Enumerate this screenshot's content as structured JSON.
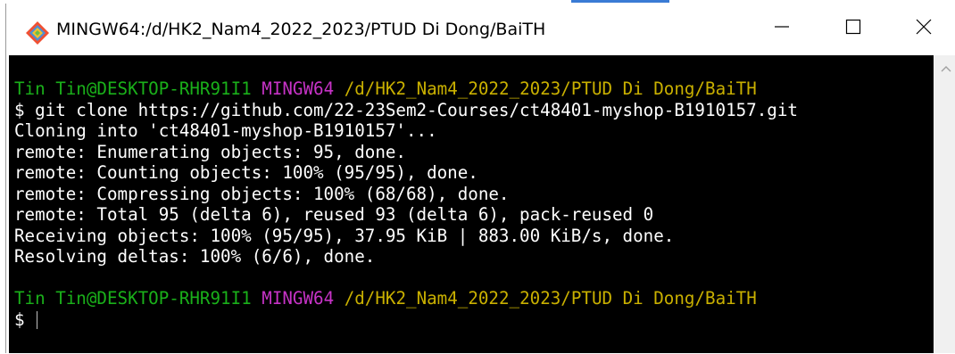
{
  "window": {
    "title": "MINGW64:/d/HK2_Nam4_2022_2023/PTUD Di Dong/BaiTH",
    "icon": "git-bash-icon",
    "controls": [
      "minimize-icon",
      "maximize-icon",
      "close-icon"
    ]
  },
  "terminal": {
    "colors": {
      "background": "#000000",
      "text": "#ffffff",
      "user_host": "#1ab01a",
      "shell": "#c733c7",
      "path": "#c9b000"
    },
    "prompt1": {
      "user_host": "Tin Tin@DESKTOP-RHR91I1",
      "shell": "MINGW64",
      "path": "/d/HK2_Nam4_2022_2023/PTUD Di Dong/BaiTH"
    },
    "command": "$ git clone https://github.com/22-23Sem2-Courses/ct48401-myshop-B1910157.git",
    "output": [
      "Cloning into 'ct48401-myshop-B1910157'...",
      "remote: Enumerating objects: 95, done.",
      "remote: Counting objects: 100% (95/95), done.",
      "remote: Compressing objects: 100% (68/68), done.",
      "remote: Total 95 (delta 6), reused 93 (delta 6), pack-reused 0",
      "Receiving objects: 100% (95/95), 37.95 KiB | 883.00 KiB/s, done.",
      "Resolving deltas: 100% (6/6), done."
    ],
    "prompt2": {
      "user_host": "Tin Tin@DESKTOP-RHR91I1",
      "shell": "MINGW64",
      "path": "/d/HK2_Nam4_2022_2023/PTUD Di Dong/BaiTH"
    },
    "current_input": "$ "
  }
}
